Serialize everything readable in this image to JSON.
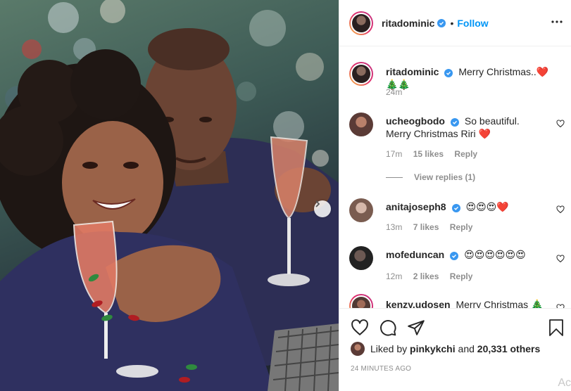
{
  "post": {
    "author": "ritadominic",
    "follow_label": "Follow",
    "dot": "•",
    "caption_user": "ritadominic",
    "caption_text": "Merry Christmas..❤️🎄🎄",
    "caption_time": "24m"
  },
  "comments": [
    {
      "user": "ucheogbodo",
      "verified": true,
      "text_line1": "So beautiful.",
      "text_line2": "Merry Christmas Riri ❤️",
      "time": "17m",
      "likes": "15 likes",
      "reply": "Reply",
      "view_replies": "View replies (1)"
    },
    {
      "user": "anitajoseph8",
      "verified": true,
      "text": "😍😍😍❤️",
      "time": "13m",
      "likes": "7 likes",
      "reply": "Reply"
    },
    {
      "user": "mofeduncan",
      "verified": true,
      "text": "😍😍😍😍😍😍",
      "time": "12m",
      "likes": "2 likes",
      "reply": "Reply"
    },
    {
      "user": "kenzy.udosen",
      "verified": false,
      "text": "Merry Christmas 🎄"
    }
  ],
  "likes_line": {
    "prefix": "Liked by",
    "user": "pinkykchi",
    "middle": "and",
    "count": "20,331 others"
  },
  "timestamp": "24 MINUTES AGO",
  "watermark": "Ac",
  "colors": {
    "accent": "#0095f6",
    "verified": "#3897f0",
    "muted": "#8e8e8e",
    "heart": "#ed4956"
  },
  "icons": [
    "heart-icon",
    "comment-icon",
    "share-icon",
    "bookmark-icon",
    "more-options-icon",
    "chevron-right-icon",
    "verified-badge-icon"
  ]
}
